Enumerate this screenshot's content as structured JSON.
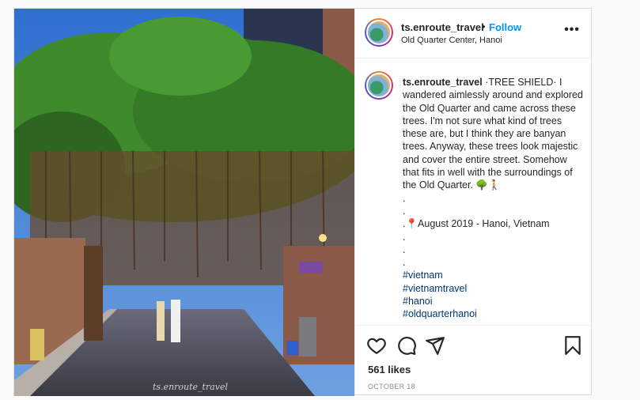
{
  "post": {
    "username": "ts.enroute_travel",
    "separator": "•",
    "follow_label": "Follow",
    "location": "Old Quarter Center, Hanoi",
    "more_label": "•••",
    "watermark": "ts.enroute_travel"
  },
  "caption": {
    "username": "ts.enroute_travel",
    "body": "·TREE SHIELD· I wandered aimlessly around and explored the Old Quarter and came across these trees. I'm not sure what kind of trees these are, but I think they are banyan trees. Anyway, these trees look majestic and cover the entire street. Somehow that fits in well with the surroundings of the Old Quarter. 🌳🚶",
    "dots": [
      ".",
      "."
    ],
    "date_line": ".📍August 2019 - Hanoi, Vietnam",
    "dots2": [
      ".",
      ".",
      "."
    ],
    "hashtags": [
      "#vietnam",
      "#vietnamtravel",
      "#hanoi",
      "#oldquarterhanoi"
    ]
  },
  "actions": {
    "likes": "561 likes",
    "date": "OCTOBER 18"
  },
  "colors": {
    "follow": "#0095f6",
    "hashtag": "#00376b"
  },
  "icons": [
    "heart-icon",
    "comment-icon",
    "share-icon",
    "bookmark-icon",
    "more-icon"
  ]
}
